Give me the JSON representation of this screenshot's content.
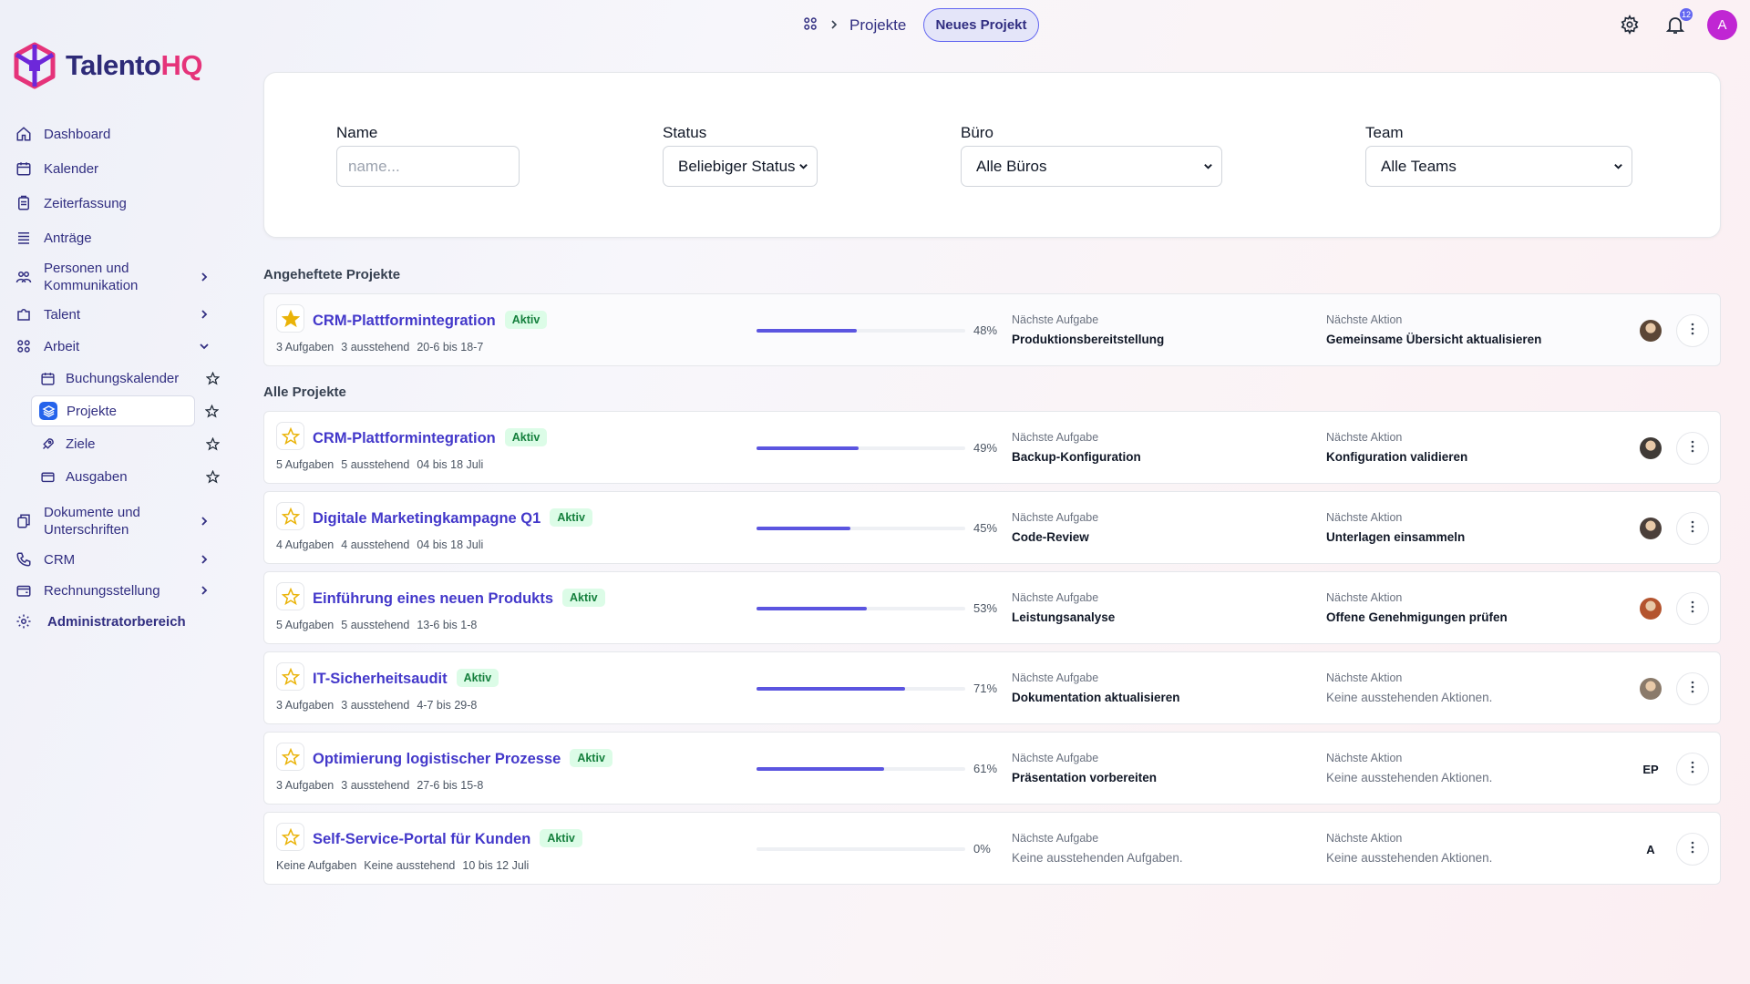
{
  "brand": {
    "name_main": "Talento",
    "name_accent": "HQ",
    "logo_colors": [
      "#e5337a",
      "#6d28d9"
    ]
  },
  "topbar": {
    "breadcrumb_current": "Projekte",
    "new_project_label": "Neues Projekt",
    "notification_count": "12",
    "user_initial": "A"
  },
  "sidebar": {
    "items": [
      {
        "label": "Dashboard",
        "icon": "home-icon"
      },
      {
        "label": "Kalender",
        "icon": "calendar-icon"
      },
      {
        "label": "Zeiterfassung",
        "icon": "clipboard-icon"
      },
      {
        "label": "Anträge",
        "icon": "list-icon"
      },
      {
        "label": "Personen und Kommunikation",
        "icon": "people-icon",
        "expandable": true
      },
      {
        "label": "Talent",
        "icon": "puzzle-icon",
        "expandable": true
      },
      {
        "label": "Arbeit",
        "icon": "grid-icon",
        "expanded": true
      },
      {
        "label": "Dokumente und Unterschriften",
        "icon": "documents-icon",
        "expandable": true
      },
      {
        "label": "CRM",
        "icon": "phone-icon",
        "expandable": true
      },
      {
        "label": "Rechnungsstellung",
        "icon": "wallet-icon",
        "expandable": true
      },
      {
        "label": "Administratorbereich",
        "icon": "gear-icon"
      }
    ],
    "work_subitems": [
      {
        "label": "Buchungskalender",
        "icon": "calendar-icon"
      },
      {
        "label": "Projekte",
        "icon": "layers-icon",
        "active": true
      },
      {
        "label": "Ziele",
        "icon": "rocket-icon"
      },
      {
        "label": "Ausgaben",
        "icon": "card-icon"
      }
    ]
  },
  "filters": {
    "name_label": "Name",
    "name_placeholder": "name...",
    "status_label": "Status",
    "status_value": "Beliebiger Status",
    "office_label": "Büro",
    "office_value": "Alle Büros",
    "team_label": "Team",
    "team_value": "Alle Teams"
  },
  "sections": {
    "pinned": "Angeheftete Projekte",
    "all": "Alle Projekte"
  },
  "column_labels": {
    "next_task": "Nächste Aufgabe",
    "next_action": "Nächste Aktion"
  },
  "pinned_projects": [
    {
      "name": "CRM-Plattformintegration",
      "status": "Aktiv",
      "tasks": "3 Aufgaben",
      "pending": "3 ausstehend",
      "dates": "20-6 bis 18-7",
      "progress_pct": 48,
      "progress_text": "48%",
      "next_task": "Produktionsbereitstellung",
      "next_action": "Gemeinsame Übersicht aktualisieren",
      "starred": true,
      "avatar": "photo"
    }
  ],
  "projects": [
    {
      "name": "CRM-Plattformintegration",
      "status": "Aktiv",
      "tasks": "5 Aufgaben",
      "pending": "5 ausstehend",
      "dates": "04 bis 18 Juli",
      "progress_pct": 49,
      "progress_text": "49%",
      "next_task": "Backup-Konfiguration",
      "next_action": "Konfiguration validieren",
      "avatar": "photo"
    },
    {
      "name": "Digitale Marketingkampagne Q1",
      "status": "Aktiv",
      "tasks": "4 Aufgaben",
      "pending": "4 ausstehend",
      "dates": "04 bis 18 Juli",
      "progress_pct": 45,
      "progress_text": "45%",
      "next_task": "Code-Review",
      "next_action": "Unterlagen einsammeln",
      "avatar": "photo"
    },
    {
      "name": "Einführung eines neuen Produkts",
      "status": "Aktiv",
      "tasks": "5 Aufgaben",
      "pending": "5 ausstehend",
      "dates": "13-6 bis 1-8",
      "progress_pct": 53,
      "progress_text": "53%",
      "next_task": "Leistungsanalyse",
      "next_action": "Offene Genehmigungen prüfen",
      "avatar": "photo"
    },
    {
      "name": "IT-Sicherheitsaudit",
      "status": "Aktiv",
      "tasks": "3 Aufgaben",
      "pending": "3 ausstehend",
      "dates": "4-7 bis 29-8",
      "progress_pct": 71,
      "progress_text": "71%",
      "next_task": "Dokumentation aktualisieren",
      "next_action": "Keine ausstehenden Aktionen.",
      "next_action_empty": true,
      "avatar": "photo"
    },
    {
      "name": "Optimierung logistischer Prozesse",
      "status": "Aktiv",
      "tasks": "3 Aufgaben",
      "pending": "3 ausstehend",
      "dates": "27-6 bis 15-8",
      "progress_pct": 61,
      "progress_text": "61%",
      "next_task": "Präsentation vorbereiten",
      "next_action": "Keine ausstehenden Aktionen.",
      "next_action_empty": true,
      "avatar": "EP"
    },
    {
      "name": "Self-Service-Portal für Kunden",
      "status": "Aktiv",
      "tasks": "Keine Aufgaben",
      "pending": "Keine ausstehend",
      "dates": "10 bis 12 Juli",
      "progress_pct": 0,
      "progress_text": "0%",
      "next_task": "Keine ausstehenden Aufgaben.",
      "next_task_empty": true,
      "next_action": "Keine ausstehenden Aktionen.",
      "next_action_empty": true,
      "avatar": "A"
    }
  ],
  "colors": {
    "accent": "#6366f1",
    "brand_dark": "#312e81",
    "link": "#4338ca",
    "badge_bg": "#dcfce7",
    "badge_text": "#15803d",
    "star": "#eab308"
  }
}
